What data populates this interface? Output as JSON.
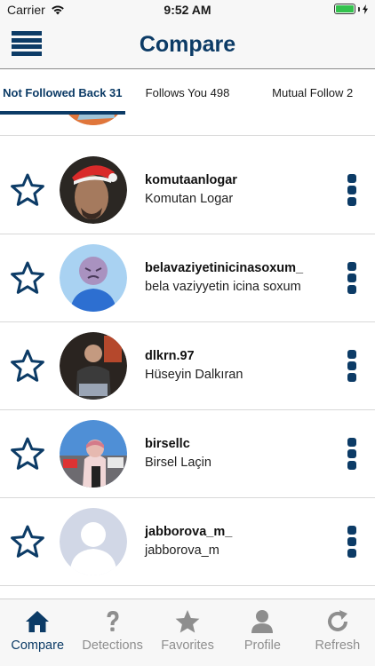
{
  "status_bar": {
    "carrier": "Carrier",
    "time": "9:52 AM",
    "battery_level": 1.0,
    "battery_color": "#33c24d"
  },
  "nav": {
    "title": "Compare",
    "menu_icon": "hamburger-menu-icon"
  },
  "tabs": [
    {
      "label": "Not Followed Back 31",
      "active": true
    },
    {
      "label": "Follows You 498",
      "active": false
    },
    {
      "label": "Mutual Follow 2",
      "active": false
    }
  ],
  "list": {
    "items": [
      {
        "username": "",
        "fullname": "",
        "avatar": "cartoon-avatar",
        "partial": true
      },
      {
        "username": "komutaanlogar",
        "fullname": "Komutan Logar",
        "avatar": "photo-avatar"
      },
      {
        "username": "belavaziyetinicinasoxum_",
        "fullname": "bela vaziyyetin icina soxum",
        "avatar": "cartoon-avatar"
      },
      {
        "username": "dlkrn.97",
        "fullname": "Hüseyin Dalkıran",
        "avatar": "photo-avatar"
      },
      {
        "username": "birsellc",
        "fullname": "Birsel Laçin",
        "avatar": "photo-avatar"
      },
      {
        "username": "jabborova_m_",
        "fullname": "jabborova_m",
        "avatar": "default-avatar"
      }
    ]
  },
  "bottom_tabs": [
    {
      "label": "Compare",
      "icon": "home-icon",
      "active": true
    },
    {
      "label": "Detections",
      "icon": "question-icon",
      "active": false
    },
    {
      "label": "Favorites",
      "icon": "star-icon",
      "active": false
    },
    {
      "label": "Profile",
      "icon": "person-icon",
      "active": false
    },
    {
      "label": "Refresh",
      "icon": "refresh-icon",
      "active": false
    }
  ],
  "colors": {
    "accent": "#0c3b66",
    "inactive": "#8e8e8e"
  }
}
